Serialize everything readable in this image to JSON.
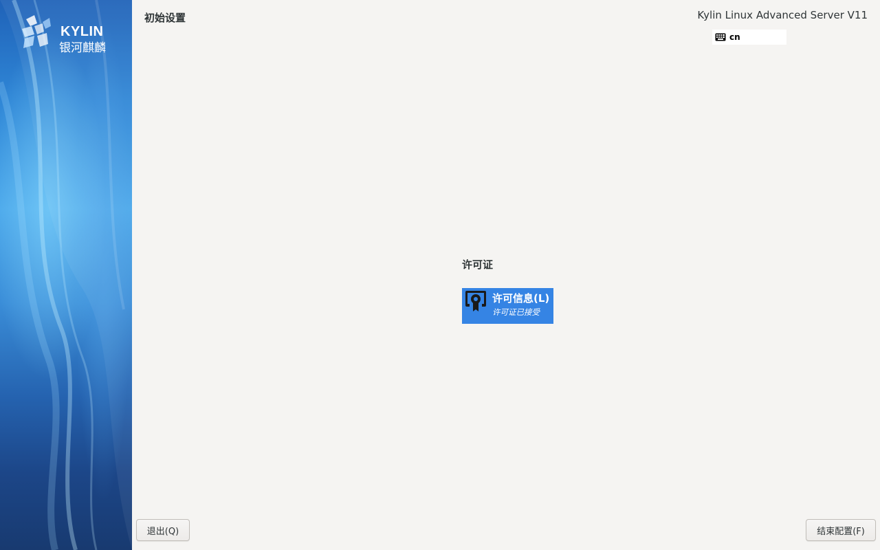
{
  "sidebar": {
    "logo": {
      "name_en": "KYLIN",
      "name_cn": "银河麒麟"
    }
  },
  "header": {
    "title": "初始设置",
    "product": "Kylin Linux Advanced Server V11",
    "keyboard_layout": "cn",
    "keyboard_icon": "keyboard-icon"
  },
  "main": {
    "section_title": "许可证",
    "spokes": [
      {
        "title": "许可信息(L)",
        "status": "许可证已接受",
        "icon": "license-certificate-icon"
      }
    ]
  },
  "footer": {
    "quit_label": "退出(Q)",
    "finish_label": "结束配置(F)"
  },
  "colors": {
    "accent": "#3584e4",
    "background": "#f5f4f2",
    "sidebar_top": "#1f62b8",
    "sidebar_bottom": "#183a70"
  }
}
